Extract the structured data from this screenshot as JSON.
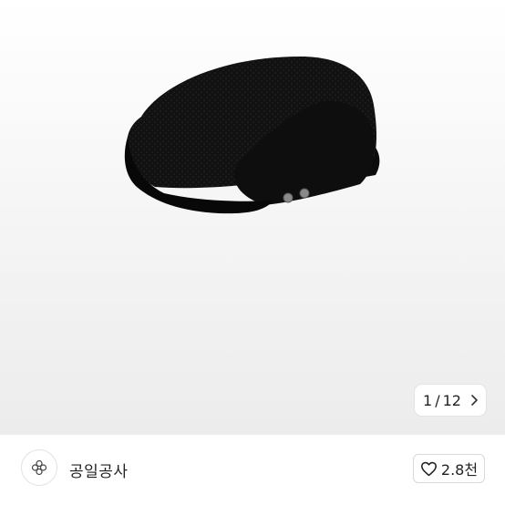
{
  "gallery": {
    "current_index": "1",
    "separator": "/",
    "total": "12"
  },
  "shop": {
    "name": "공일공사"
  },
  "like_button": {
    "count": "2.8천"
  }
}
